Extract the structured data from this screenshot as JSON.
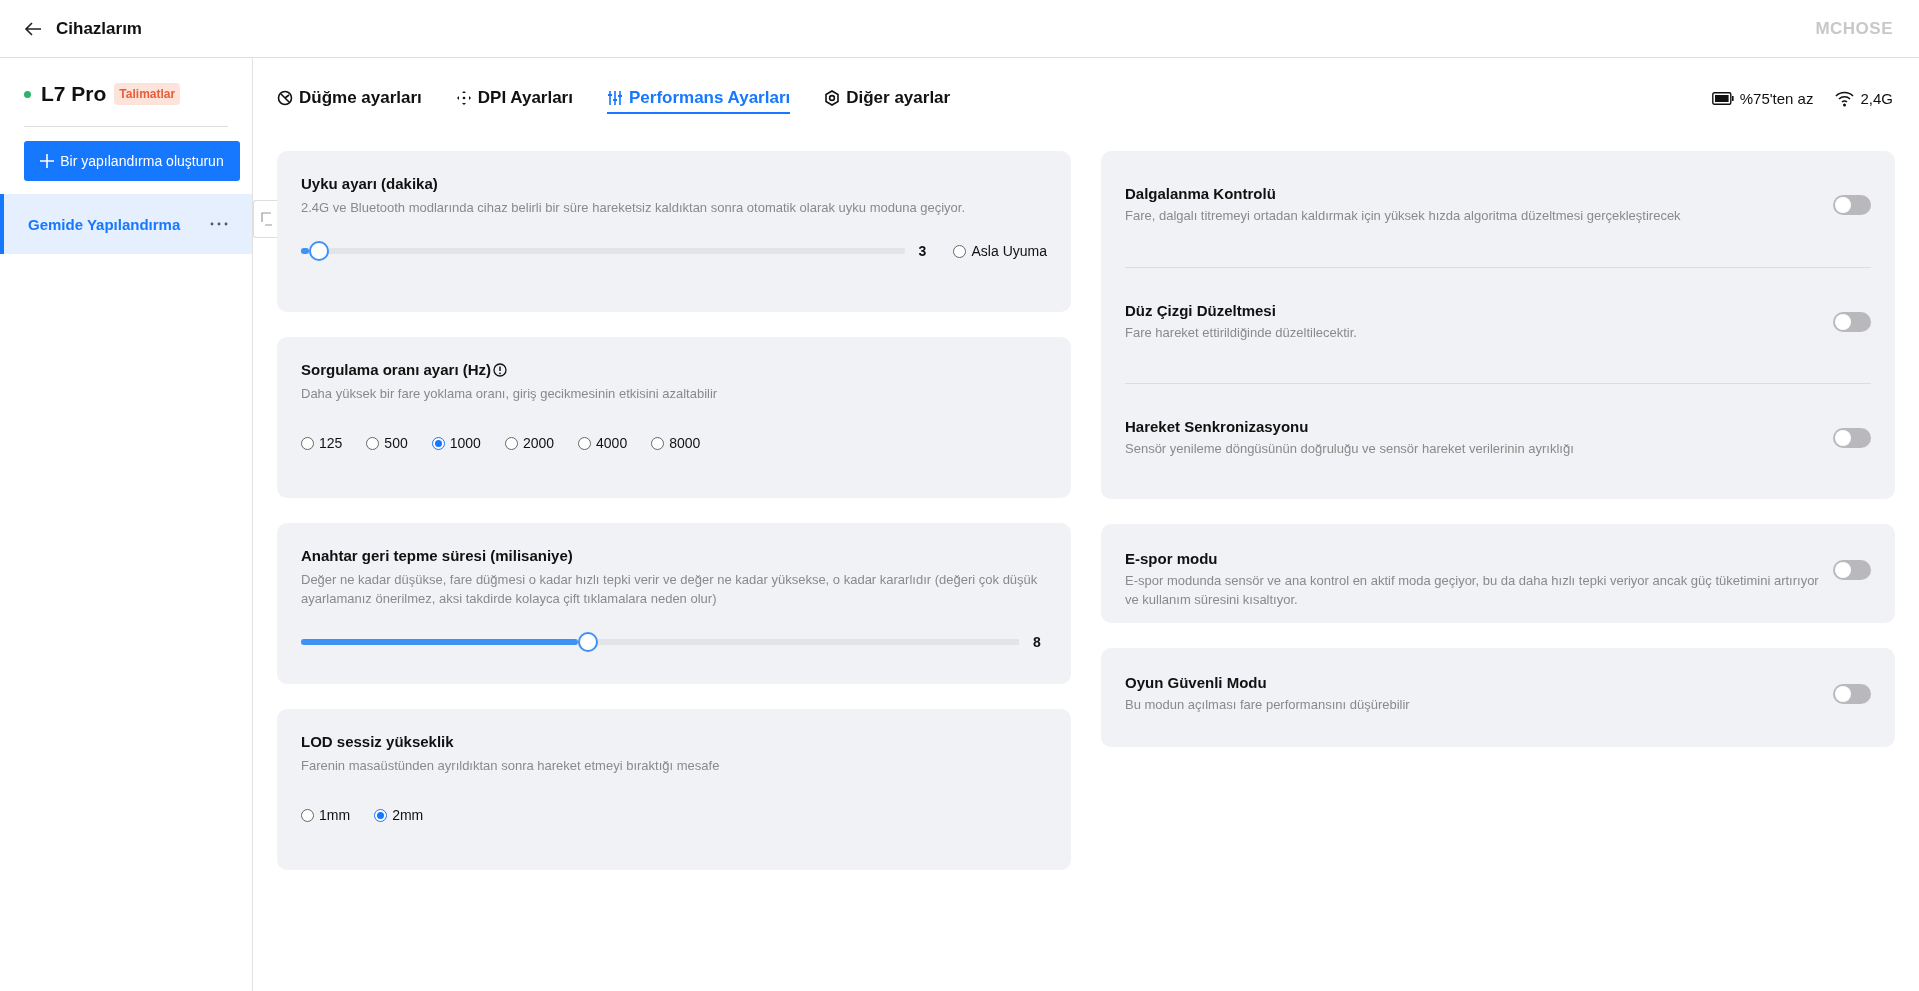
{
  "header": {
    "title": "Cihazlarım",
    "brand": "MCHOSE"
  },
  "device": {
    "name": "L7 Pro",
    "connected": true,
    "badge": "Talimatlar"
  },
  "create_button": "Bir yapılandırma oluşturun",
  "profiles": [
    {
      "label": "Gemide Yapılandırma",
      "selected": true
    }
  ],
  "tabs": [
    {
      "label": "Düğme ayarları",
      "kind": "button",
      "selected": false
    },
    {
      "label": "DPI Ayarları",
      "kind": "dpi",
      "selected": false
    },
    {
      "label": "Performans Ayarları",
      "kind": "performance",
      "selected": true
    },
    {
      "label": "Diğer ayarlar",
      "kind": "other",
      "selected": false
    }
  ],
  "status": {
    "battery": "%75'ten az",
    "connection": "2,4G"
  },
  "left_cards": [
    {
      "kind": "slider",
      "title": "Uyku ayarı (dakika)",
      "description": "2.4G ve Bluetooth modlarında cihaz belirli bir süre hareketsiz kaldıktan sonra otomatik olarak uyku moduna geçiyor.",
      "level": 0.03,
      "reading": "3",
      "option": {
        "label": "Asla Uyuma",
        "selected": false
      }
    },
    {
      "kind": "radio",
      "title": "Sorgulama oranı ayarı (Hz)",
      "info": true,
      "description": "Daha yüksek bir fare yoklama oranı, giriş gecikmesinin etkisini azaltabilir",
      "options": [
        {
          "label": "125",
          "selected": false
        },
        {
          "label": "500",
          "selected": false
        },
        {
          "label": "1000",
          "selected": true
        },
        {
          "label": "2000",
          "selected": false
        },
        {
          "label": "4000",
          "selected": false
        },
        {
          "label": "8000",
          "selected": false
        }
      ]
    },
    {
      "kind": "slider",
      "title": "Anahtar geri tepme süresi (milisaniye)",
      "description": "Değer ne kadar düşükse, fare düğmesi o kadar hızlı tepki verir ve değer ne kadar yüksekse, o kadar kararlıdır (değeri çok düşük ayarlamanız önerilmez, aksi takdirde kolayca çift tıklamalara neden olur)",
      "level": 0.4,
      "reading": "8"
    },
    {
      "kind": "radio",
      "title": "LOD sessiz yükseklik",
      "description": "Farenin masaüstünden ayrıldıktan sonra hareket etmeyi bıraktığı mesafe",
      "options": [
        {
          "label": "1mm",
          "selected": false
        },
        {
          "label": "2mm",
          "selected": true
        }
      ]
    }
  ],
  "right_cards": [
    {
      "items": [
        {
          "title": "Dalgalanma Kontrolü",
          "description": "Fare, dalgalı titremeyi ortadan kaldırmak için yüksek hızda algoritma düzeltmesi gerçekleştirecek",
          "on": false
        },
        {
          "title": "Düz Çizgi Düzeltmesi",
          "description": "Fare hareket ettirildiğinde düzeltilecektir.",
          "on": false
        },
        {
          "title": "Hareket Senkronizasyonu",
          "description": "Sensör yenileme döngüsünün doğruluğu ve sensör hareket verilerinin ayrıklığı",
          "on": false
        }
      ]
    },
    {
      "items": [
        {
          "title": "E-spor modu",
          "description": "E-spor modunda sensör ve ana kontrol en aktif moda geçiyor, bu da daha hızlı tepki veriyor ancak güç tüketimini artırıyor ve kullanım süresini kısaltıyor.",
          "on": false
        }
      ]
    },
    {
      "items": [
        {
          "title": "Oyun Güvenli Modu",
          "description": "Bu modun açılması fare performansını düşürebilir",
          "on": false
        }
      ]
    }
  ]
}
